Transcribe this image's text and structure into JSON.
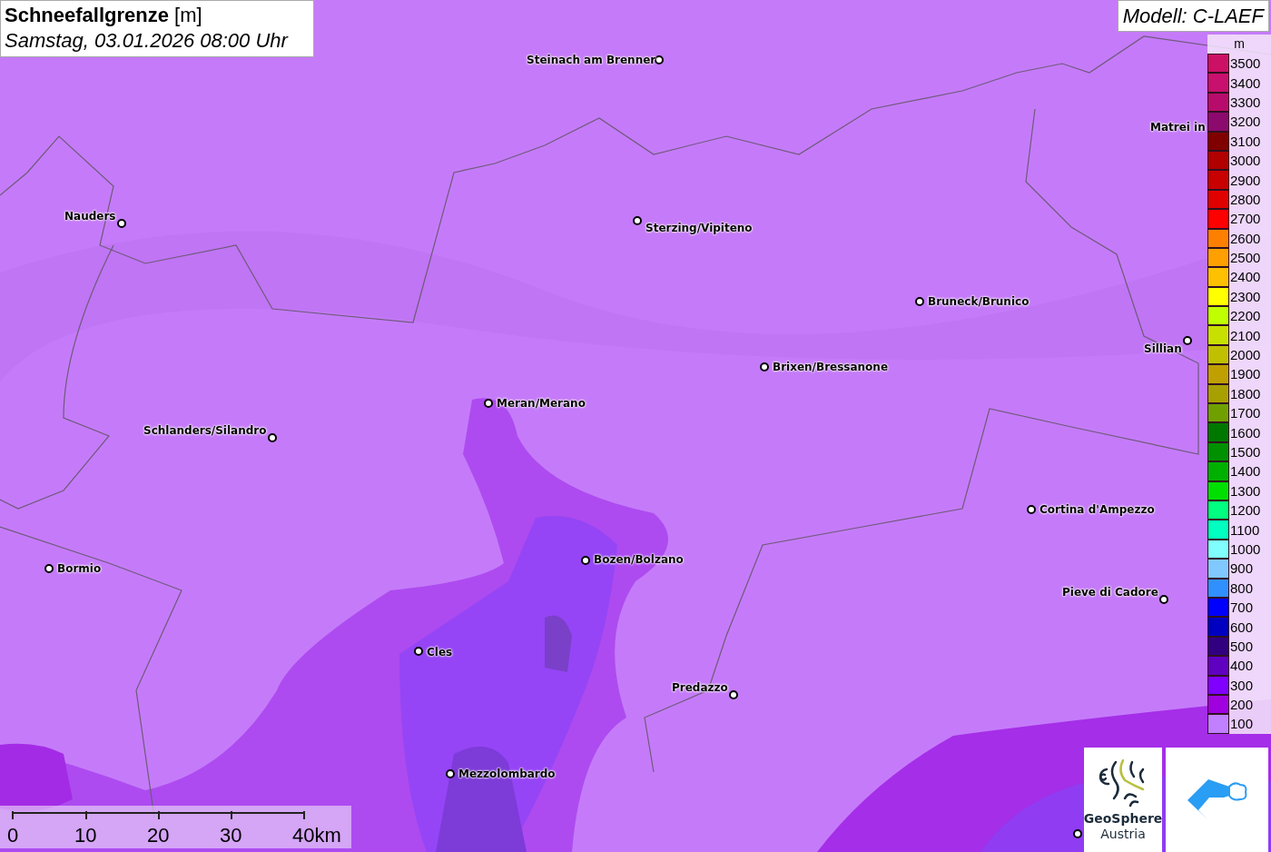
{
  "title": {
    "text": "**Schneefallgrenze** [m]",
    "subtitle": "Samstag, 03.01.2026 08:00 Uhr"
  },
  "model": "Modell: C-LAEF",
  "places": [
    {
      "name": "Steinach am Brenner"
    },
    {
      "name": "Matrei in"
    },
    {
      "name": "Nauders"
    },
    {
      "name": "Sterzing/Vipiteno"
    },
    {
      "name": "Bruneck/Brunico"
    },
    {
      "name": "Sillian"
    },
    {
      "name": "Brixen/Bressanone"
    },
    {
      "name": "Meran/Merano"
    },
    {
      "name": "Schlanders/Silandro"
    },
    {
      "name": "Cortina d'Ampezzo"
    },
    {
      "name": "Bormio"
    },
    {
      "name": "Bozen/Bolzano"
    },
    {
      "name": "Pieve di Cadore"
    },
    {
      "name": "Cles"
    },
    {
      "name": "Predazzo"
    },
    {
      "name": "Mezzolombardo"
    }
  ],
  "legend": {
    "unit": "m",
    "items": [
      {
        "label": "3500",
        "color": "#cc1066"
      },
      {
        "label": "3400",
        "color": "#c8106e"
      },
      {
        "label": "3300",
        "color": "#b80c6c"
      },
      {
        "label": "3200",
        "color": "#8c0a6e"
      },
      {
        "label": "3100",
        "color": "#800000"
      },
      {
        "label": "3000",
        "color": "#b00000"
      },
      {
        "label": "2900",
        "color": "#c80000"
      },
      {
        "label": "2800",
        "color": "#e00000"
      },
      {
        "label": "2700",
        "color": "#ff0000"
      },
      {
        "label": "2600",
        "color": "#ff8000"
      },
      {
        "label": "2500",
        "color": "#ffa000"
      },
      {
        "label": "2400",
        "color": "#ffc000"
      },
      {
        "label": "2300",
        "color": "#ffff00"
      },
      {
        "label": "2200",
        "color": "#c0ff00"
      },
      {
        "label": "2100",
        "color": "#c8e000"
      },
      {
        "label": "2000",
        "color": "#c0c000"
      },
      {
        "label": "1900",
        "color": "#c0a000"
      },
      {
        "label": "1800",
        "color": "#a8a000"
      },
      {
        "label": "1700",
        "color": "#70a000"
      },
      {
        "label": "1600",
        "color": "#007800"
      },
      {
        "label": "1500",
        "color": "#009000"
      },
      {
        "label": "1400",
        "color": "#00b000"
      },
      {
        "label": "1300",
        "color": "#00e000"
      },
      {
        "label": "1200",
        "color": "#00ff80"
      },
      {
        "label": "1100",
        "color": "#00ffc0"
      },
      {
        "label": "1000",
        "color": "#80ffff"
      },
      {
        "label": "900",
        "color": "#80c8ff"
      },
      {
        "label": "800",
        "color": "#3090ff"
      },
      {
        "label": "700",
        "color": "#0000ff"
      },
      {
        "label": "600",
        "color": "#0000c0"
      },
      {
        "label": "500",
        "color": "#300080"
      },
      {
        "label": "400",
        "color": "#6000c0"
      },
      {
        "label": "300",
        "color": "#8000ff"
      },
      {
        "label": "200",
        "color": "#a000e0"
      },
      {
        "label": "100",
        "color": "#c080ff"
      }
    ]
  },
  "scale": {
    "ticks": [
      "0",
      "10",
      "20",
      "30",
      "40km"
    ]
  },
  "logo": {
    "lines": [
      "GeoSphere",
      "Austria"
    ]
  }
}
